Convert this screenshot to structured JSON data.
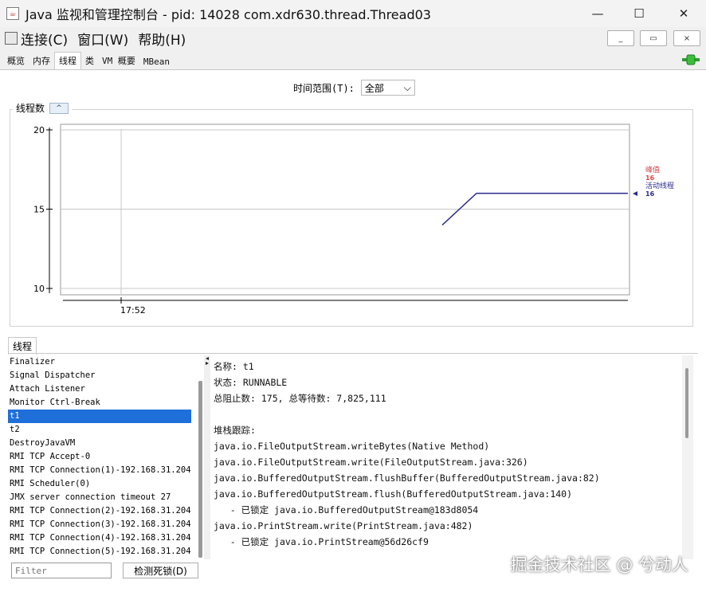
{
  "window": {
    "title": "Java 监视和管理控制台 - pid: 14028 com.xdr630.thread.Thread03",
    "controls": {
      "minimize": "—",
      "maximize": "☐",
      "close": "✕"
    }
  },
  "menu": {
    "items": [
      "连接(C)",
      "窗口(W)",
      "帮助(H)"
    ],
    "mdi_controls": [
      "_",
      "▭",
      "×"
    ]
  },
  "tabs": [
    {
      "label": "概览",
      "active": false
    },
    {
      "label": "内存",
      "active": false
    },
    {
      "label": "线程",
      "active": true
    },
    {
      "label": "类",
      "active": false
    },
    {
      "label": "VM 概要",
      "active": false
    },
    {
      "label": "MBean",
      "active": false
    }
  ],
  "time_range": {
    "label": "时间范围(T):",
    "value": "全部",
    "arrow": "⌵"
  },
  "chart_panel": {
    "title": "线程数",
    "collapse_icon": "^"
  },
  "chart_data": {
    "type": "line",
    "x": [
      "17:52"
    ],
    "ylim": [
      10,
      20
    ],
    "yticks": [
      10,
      15,
      20
    ],
    "xtick_labels": [
      "17:52"
    ],
    "grid": true,
    "series": [
      {
        "name": "峰值",
        "value": 16,
        "color": "#d8424a"
      },
      {
        "name": "活动线程",
        "value": 16,
        "color": "#2b2b8f",
        "points": [
          14,
          16,
          16
        ]
      }
    ],
    "legend_placement": "right"
  },
  "threads_section": {
    "tab_label": "线程",
    "list": [
      "Finalizer",
      "Signal Dispatcher",
      "Attach Listener",
      "Monitor Ctrl-Break",
      "t1",
      "t2",
      "DestroyJavaVM",
      "RMI TCP Accept-0",
      "RMI TCP Connection(1)-192.168.31.204",
      "RMI Scheduler(0)",
      "JMX server connection timeout 27",
      "RMI TCP Connection(2)-192.168.31.204",
      "RMI TCP Connection(3)-192.168.31.204",
      "RMI TCP Connection(4)-192.168.31.204",
      "RMI TCP Connection(5)-192.168.31.204"
    ],
    "selected": "t1",
    "detail_lines": [
      "名称: t1",
      "状态: RUNNABLE",
      "总阻止数: 175, 总等待数: 7,825,111",
      "",
      "堆栈跟踪:",
      "java.io.FileOutputStream.writeBytes(Native Method)",
      "java.io.FileOutputStream.write(FileOutputStream.java:326)",
      "java.io.BufferedOutputStream.flushBuffer(BufferedOutputStream.java:82)",
      "java.io.BufferedOutputStream.flush(BufferedOutputStream.java:140)",
      "   - 已锁定 java.io.BufferedOutputStream@183d8054",
      "java.io.PrintStream.write(PrintStream.java:482)",
      "   - 已锁定 java.io.PrintStream@56d26cf9"
    ],
    "filter_placeholder": "Filter",
    "deadlock_button": "检测死锁(D)"
  },
  "watermark": "掘金技术社区 @ 兮动人"
}
